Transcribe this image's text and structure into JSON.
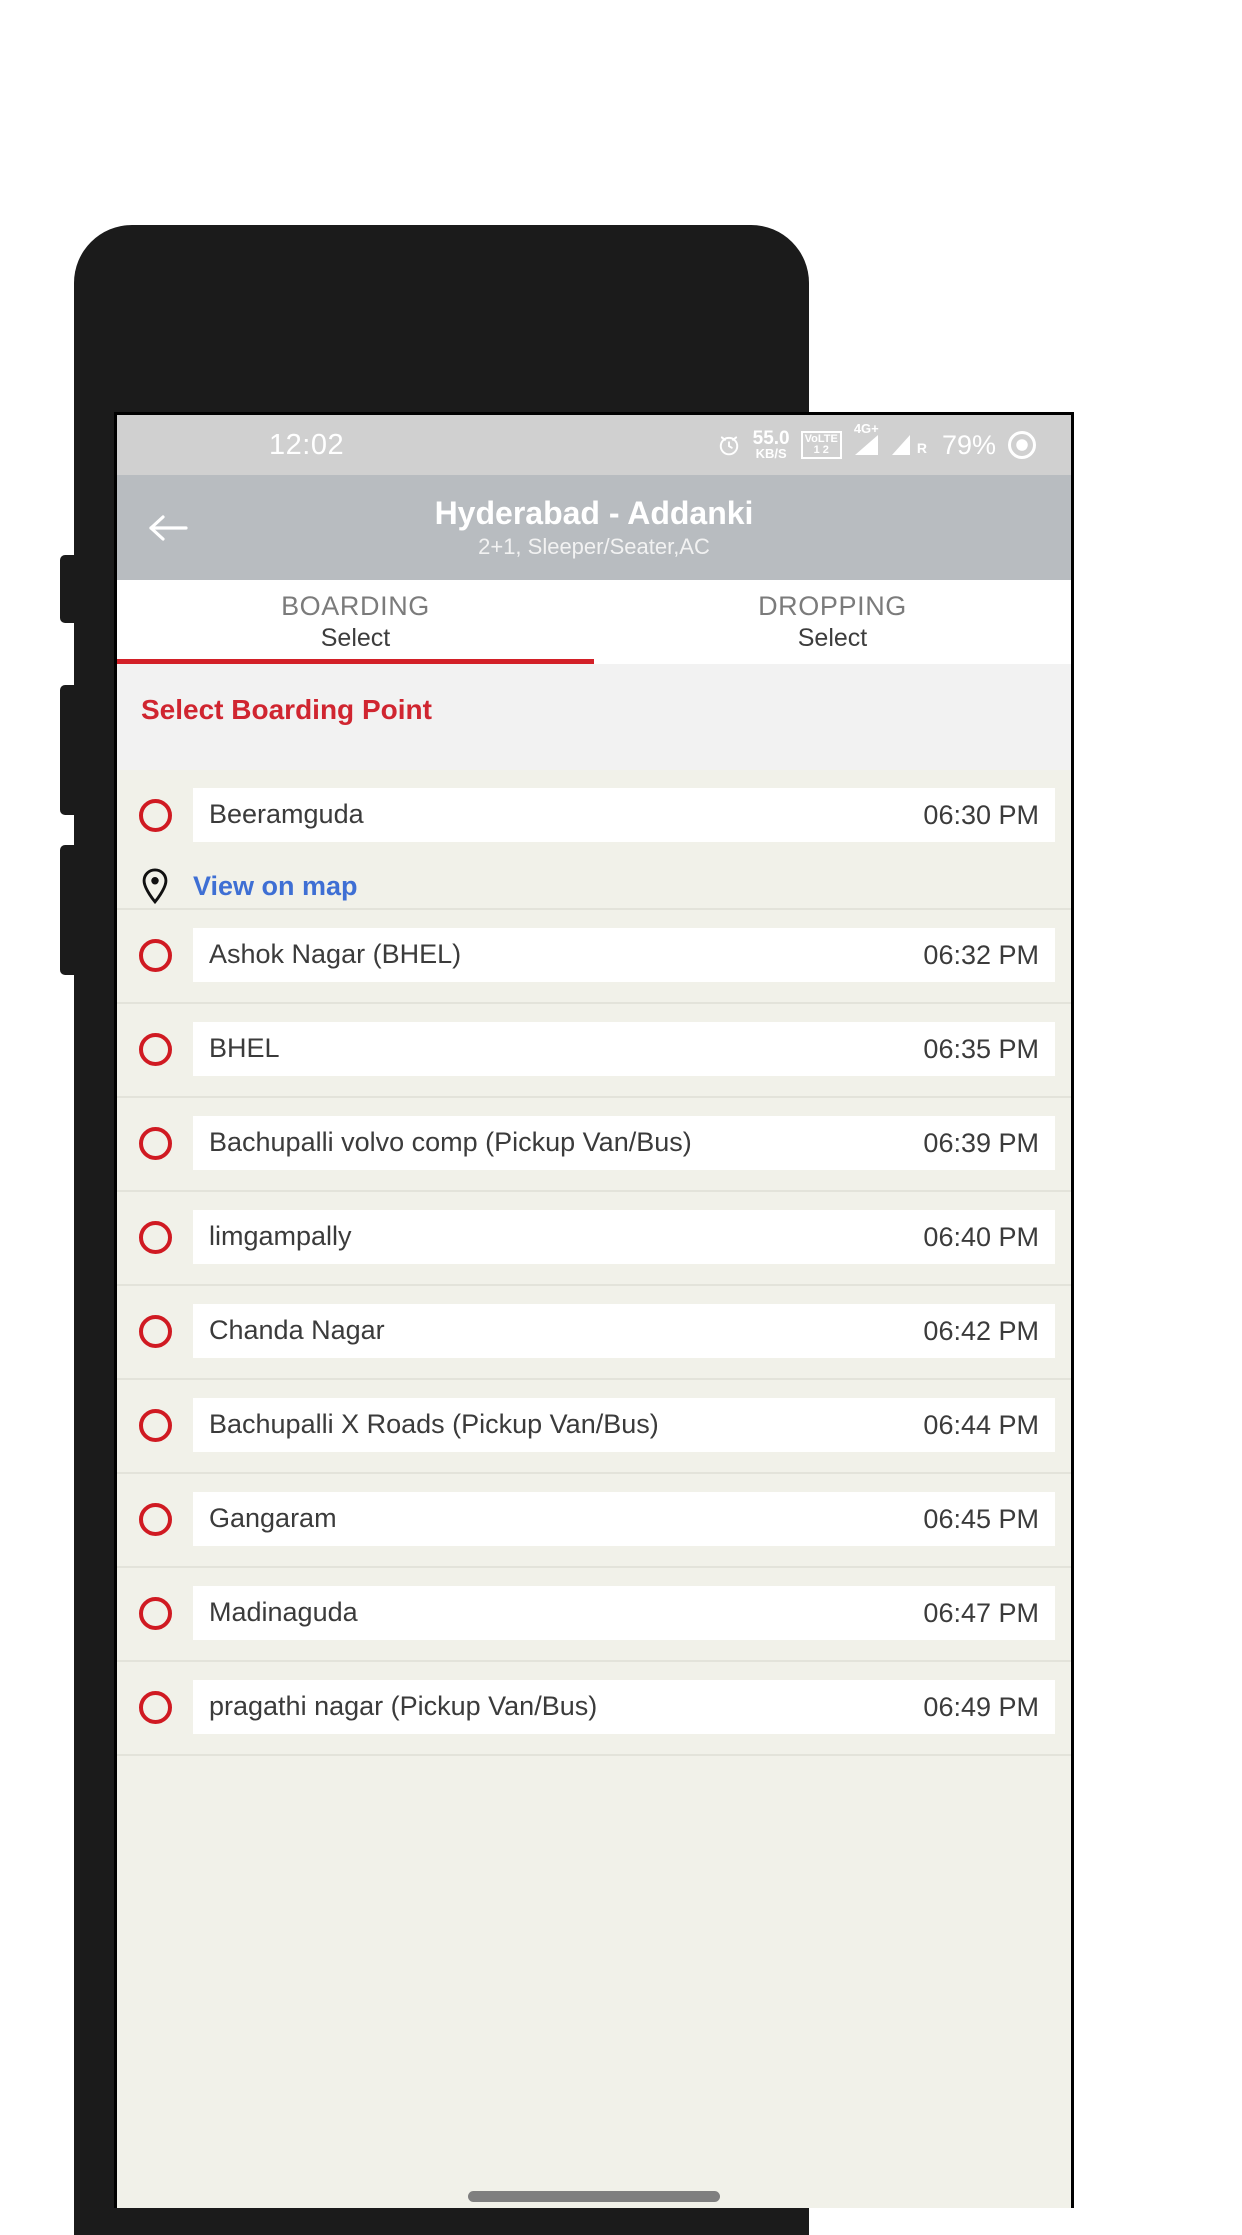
{
  "status_bar": {
    "time": "12:02",
    "alarm_icon": "alarm-clock-icon",
    "net_speed_value": "55.0",
    "net_speed_unit": "KB/S",
    "volte_line1": "VoLTE",
    "volte_line2": "1  2",
    "network_type": "4G+",
    "roaming_label": "R",
    "battery_percent": "79%",
    "eye_icon": "eye-icon"
  },
  "header": {
    "back_icon": "back-arrow-icon",
    "title": "Hyderabad - Addanki",
    "subtitle": "2+1, Sleeper/Seater,AC"
  },
  "tabs": [
    {
      "title": "BOARDING",
      "subtitle": "Select",
      "active": true
    },
    {
      "title": "DROPPING",
      "subtitle": "Select",
      "active": false
    }
  ],
  "section": {
    "title": "Select Boarding Point",
    "title_color": "#d02530"
  },
  "map_link": {
    "icon": "map-pin-icon",
    "label": "View on map"
  },
  "boarding_points": [
    {
      "name": "Beeramguda",
      "time": "06:30 PM",
      "has_map_link": true
    },
    {
      "name": "Ashok Nagar (BHEL)",
      "time": "06:32 PM",
      "has_map_link": false
    },
    {
      "name": "BHEL",
      "time": "06:35 PM",
      "has_map_link": false
    },
    {
      "name": "Bachupalli volvo comp  (Pickup Van/Bus)",
      "time": "06:39 PM",
      "has_map_link": false
    },
    {
      "name": "limgampally",
      "time": "06:40 PM",
      "has_map_link": false
    },
    {
      "name": "Chanda Nagar",
      "time": "06:42 PM",
      "has_map_link": false
    },
    {
      "name": "Bachupalli X Roads  (Pickup Van/Bus)",
      "time": "06:44 PM",
      "has_map_link": false
    },
    {
      "name": "Gangaram",
      "time": "06:45 PM",
      "has_map_link": false
    },
    {
      "name": "Madinaguda",
      "time": "06:47 PM",
      "has_map_link": false
    },
    {
      "name": "pragathi nagar  (Pickup Van/Bus)",
      "time": "06:49 PM",
      "has_map_link": false
    }
  ],
  "colors": {
    "accent_red": "#d01a22",
    "link_blue": "#3e6fd4",
    "header_grey": "#b8bcc0",
    "row_bg": "#f1f1e9"
  }
}
